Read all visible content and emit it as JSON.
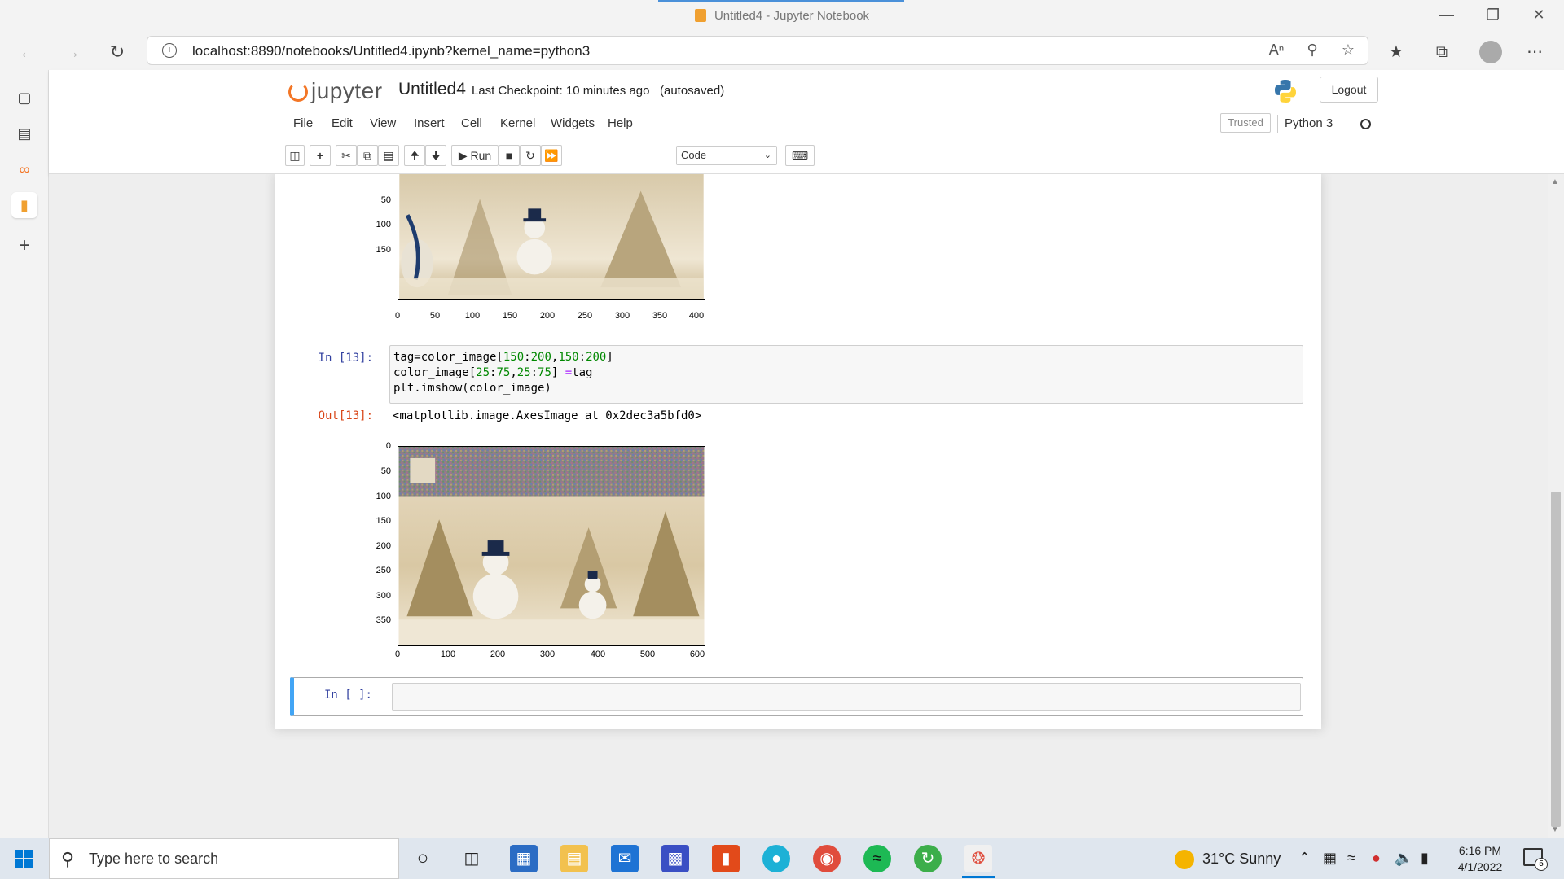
{
  "browser": {
    "window_title": "Untitled4 - Jupyter Notebook",
    "url": "localhost:8890/notebooks/Untitled4.ipynb?kernel_name=python3"
  },
  "jupyter": {
    "logo_text": "jupyter",
    "notebook_name": "Untitled4",
    "checkpoint": "Last Checkpoint: 10 minutes ago",
    "autosave": "(autosaved)",
    "logout_label": "Logout",
    "menu": [
      "File",
      "Edit",
      "View",
      "Insert",
      "Cell",
      "Kernel",
      "Widgets",
      "Help"
    ],
    "trusted_label": "Trusted",
    "kernel_label": "Python 3",
    "run_label": "Run",
    "cell_type": "Code"
  },
  "cells": {
    "plot1_yticks": [
      "50",
      "100",
      "150"
    ],
    "plot1_xticks": [
      "0",
      "50",
      "100",
      "150",
      "200",
      "250",
      "300",
      "350",
      "400"
    ],
    "cell13_in_prompt": "In [13]:",
    "cell13_code_line1_a": "tag=color_image[",
    "cell13_code_line1_b": "150",
    "cell13_code_line1_c": ":",
    "cell13_code_line1_d": "200",
    "cell13_code_line1_e": ",",
    "cell13_code_line1_f": "150",
    "cell13_code_line1_g": ":",
    "cell13_code_line1_h": "200",
    "cell13_code_line1_i": "]",
    "cell13_code_line2_a": "color_image[",
    "cell13_code_line2_b": "25",
    "cell13_code_line2_c": ":",
    "cell13_code_line2_d": "75",
    "cell13_code_line2_e": ",",
    "cell13_code_line2_f": "25",
    "cell13_code_line2_g": ":",
    "cell13_code_line2_h": "75",
    "cell13_code_line2_i": "] ",
    "cell13_code_line2_j": "=",
    "cell13_code_line2_k": "tag",
    "cell13_code_line3": "plt.imshow(color_image)",
    "cell13_out_prompt": "Out[13]:",
    "cell13_output": "<matplotlib.image.AxesImage at 0x2dec3a5bfd0>",
    "plot2_yticks": [
      "0",
      "50",
      "100",
      "150",
      "200",
      "250",
      "300",
      "350"
    ],
    "plot2_xticks": [
      "0",
      "100",
      "200",
      "300",
      "400",
      "500",
      "600"
    ],
    "empty_prompt": "In [ ]:"
  },
  "taskbar": {
    "search_placeholder": "Type here to search",
    "weather": "31°C  Sunny",
    "time": "6:16 PM",
    "date": "4/1/2022",
    "notification_count": "5"
  }
}
